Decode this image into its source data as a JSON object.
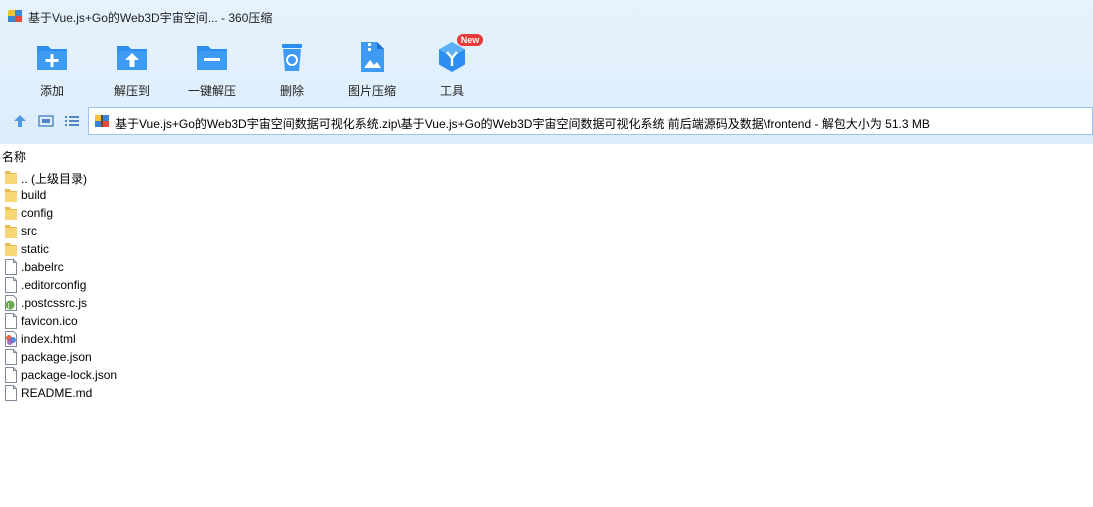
{
  "window": {
    "title": "基于Vue.js+Go的Web3D宇宙空间... - 360压缩"
  },
  "toolbar": {
    "add_label": "添加",
    "extract_to_label": "解压到",
    "one_click_extract_label": "一键解压",
    "delete_label": "删除",
    "image_compress_label": "图片压缩",
    "tools_label": "工具",
    "tools_badge": "New"
  },
  "address": {
    "path": "基于Vue.js+Go的Web3D宇宙空间数据可视化系统.zip\\基于Vue.js+Go的Web3D宇宙空间数据可视化系统 前后端源码及数据\\frontend - 解包大小为 51.3 MB"
  },
  "list": {
    "column_name": "名称",
    "items": [
      {
        "name": ".. (上级目录)",
        "icon": "folder-icon"
      },
      {
        "name": "build",
        "icon": "folder-icon"
      },
      {
        "name": "config",
        "icon": "folder-icon"
      },
      {
        "name": "src",
        "icon": "folder-icon"
      },
      {
        "name": "static",
        "icon": "folder-icon"
      },
      {
        "name": ".babelrc",
        "icon": "file-icon"
      },
      {
        "name": ".editorconfig",
        "icon": "file-icon"
      },
      {
        "name": ".postcssrc.js",
        "icon": "js-file-icon"
      },
      {
        "name": "favicon.ico",
        "icon": "file-icon"
      },
      {
        "name": "index.html",
        "icon": "html-file-icon"
      },
      {
        "name": "package.json",
        "icon": "file-icon"
      },
      {
        "name": "package-lock.json",
        "icon": "file-icon"
      },
      {
        "name": "README.md",
        "icon": "file-icon"
      }
    ]
  },
  "colors": {
    "toolbar_bg": "#e6f3fd",
    "icon_blue": "#2b8ef0",
    "folder_yellow": "#f7d675",
    "badge_red": "#e83a3a"
  }
}
